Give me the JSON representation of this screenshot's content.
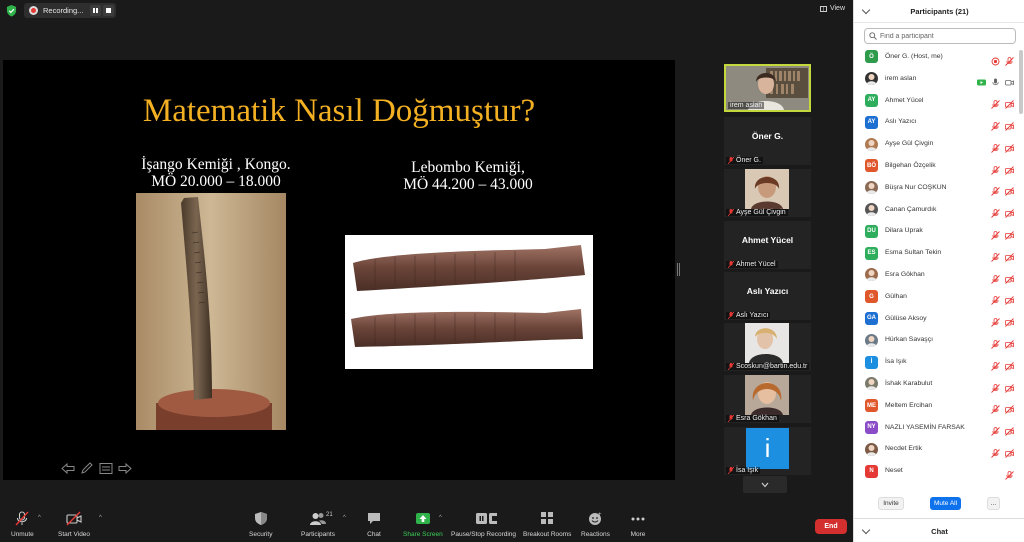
{
  "topbar": {
    "recording_label": "Recording...",
    "view_label": "View"
  },
  "slide": {
    "title": "Matematik Nasıl Doğmuştur?",
    "left_caption_line1": "İşango Kemiği , Kongo.",
    "left_caption_line2": "MÖ 20.000 – 18.000",
    "right_caption_line1": "Lebombo Kemiği,",
    "right_caption_line2": "MÖ 44.200 – 43.000"
  },
  "video_strip": [
    {
      "name": "irem aslan",
      "big": "",
      "type": "video",
      "active": true
    },
    {
      "name": "Öner G.",
      "big": "Öner G.",
      "type": "name"
    },
    {
      "name": "Ayşe Gül Çivgin",
      "big": "",
      "type": "photo"
    },
    {
      "name": "Ahmet Yücel",
      "big": "Ahmet Yücel",
      "type": "name"
    },
    {
      "name": "Aslı Yazıcı",
      "big": "Aslı Yazıcı",
      "type": "name"
    },
    {
      "name": "Scoskun@bartin.edu.tr",
      "big": "",
      "type": "photo"
    },
    {
      "name": "Esra Gökhan",
      "big": "",
      "type": "photo"
    },
    {
      "name": "İsa Işık",
      "big": "i",
      "type": "letter"
    }
  ],
  "toolbar": {
    "unmute": "Unmute",
    "start_video": "Start Video",
    "security": "Security",
    "participants": "Participants",
    "participants_count": "21",
    "chat": "Chat",
    "share_screen": "Share Screen",
    "pause_recording": "Pause/Stop Recording",
    "breakout": "Breakout Rooms",
    "reactions": "Reactions",
    "more": "More",
    "end": "End"
  },
  "panel": {
    "title": "Participants (21)",
    "search_placeholder": "Find a participant",
    "invite": "Invite",
    "mute_all": "Mute All",
    "more": "...",
    "chat_title": "Chat"
  },
  "participants": [
    {
      "initials": "Ö",
      "name": "Öner G. (Host, me)",
      "color": "#2e9c4a",
      "status": "host"
    },
    {
      "initials": "",
      "name": "irem aslan",
      "color": "#333333",
      "status": "live"
    },
    {
      "initials": "AY",
      "name": "Ahmet Yücel",
      "color": "#2eae5c",
      "status": "muted"
    },
    {
      "initials": "AY",
      "name": "Aslı Yazıcı",
      "color": "#1d6fd1",
      "status": "muted"
    },
    {
      "initials": "",
      "name": "Ayşe Gül Çivgin",
      "color": "#b07a52",
      "status": "muted"
    },
    {
      "initials": "BÖ",
      "name": "Bilgehan Özçelik",
      "color": "#e0572b",
      "status": "muted"
    },
    {
      "initials": "",
      "name": "Büşra Nur COŞKUN",
      "color": "#8a6a55",
      "status": "muted"
    },
    {
      "initials": "",
      "name": "Canan Çamurdık",
      "color": "#555555",
      "status": "muted"
    },
    {
      "initials": "DU",
      "name": "Dilara Uprak",
      "color": "#2eae5c",
      "status": "muted"
    },
    {
      "initials": "ES",
      "name": "Esma Sultan Tekin",
      "color": "#2eae5c",
      "status": "muted"
    },
    {
      "initials": "",
      "name": "Esra Gökhan",
      "color": "#9c6b4b",
      "status": "muted"
    },
    {
      "initials": "G",
      "name": "Gülhan",
      "color": "#e0572b",
      "status": "muted"
    },
    {
      "initials": "GA",
      "name": "Gülüse Aksoy",
      "color": "#1d6fd1",
      "status": "muted"
    },
    {
      "initials": "",
      "name": "Hürkan Savaşçı",
      "color": "#6a7a88",
      "status": "muted"
    },
    {
      "initials": "İ",
      "name": "İsa Işık",
      "color": "#1d8fe0",
      "status": "muted"
    },
    {
      "initials": "",
      "name": "İshak Karabulut",
      "color": "#7a7a6a",
      "status": "muted"
    },
    {
      "initials": "ME",
      "name": "Meltem Ercihan",
      "color": "#e0572b",
      "status": "muted"
    },
    {
      "initials": "NY",
      "name": "NAZLI YASEMİN FARSAK",
      "color": "#8b4cc7",
      "status": "muted"
    },
    {
      "initials": "",
      "name": "Necdet Ertik",
      "color": "#7c5a45",
      "status": "muted"
    },
    {
      "initials": "N",
      "name": "Neset",
      "color": "#e53935",
      "status": "muted-audio"
    }
  ],
  "colors": {
    "accent_blue": "#0e72ed",
    "mute_red": "#e53935",
    "title_gold": "#f3b022",
    "active_tile": "#c3d93b"
  }
}
